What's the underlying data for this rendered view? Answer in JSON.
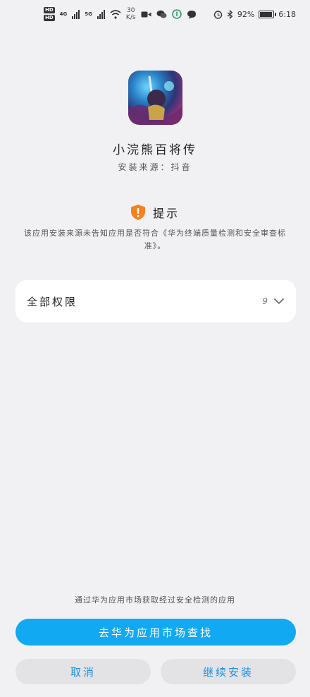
{
  "status_bar": {
    "hd1": "HD",
    "hd2": "HD",
    "net1": "4G",
    "net2": "5G",
    "speed_value": "30",
    "speed_unit": "K/s",
    "battery": "92%",
    "time": "6:18",
    "icons": [
      "video-icon",
      "wechat-icon",
      "app-notify-icon",
      "message-icon",
      "alarm-icon",
      "bluetooth-icon"
    ]
  },
  "app": {
    "name": "小浣熊百将传",
    "install_source": "安装来源：抖音"
  },
  "notice": {
    "title": "提示",
    "body": "该应用安装来源未告知应用是否符合《华为终端质量检测和安全审查标准》。"
  },
  "permissions": {
    "label": "全部权限",
    "count": "9"
  },
  "market": {
    "hint": "通过华为应用市场获取经过安全检测的应用",
    "button": "去华为应用市场查找"
  },
  "actions": {
    "cancel": "取消",
    "continue": "继续安装"
  },
  "colors": {
    "primary": "#12a9f3",
    "warning": "#f58220",
    "link": "#1d8fe0",
    "background": "#f1f1f3"
  }
}
